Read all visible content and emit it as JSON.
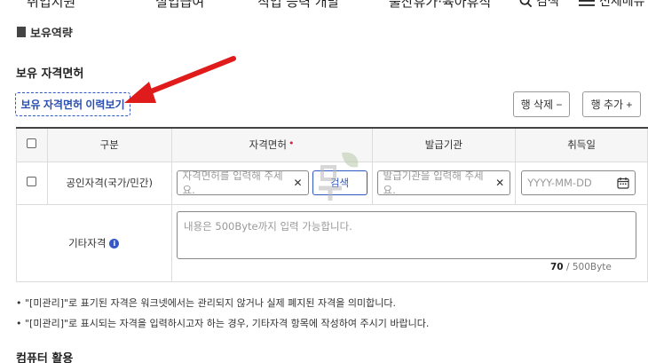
{
  "nav": {
    "items": [
      "취업지원",
      "실업급여",
      "직업 능력 개발",
      "출산휴가·육아휴직"
    ],
    "search_label": "검색",
    "menu_label": "전체메뉴"
  },
  "section_cut_title": "보유역량",
  "section_title": "보유 자격면허",
  "history_button": "보유 자격면허 이력보기",
  "delete_row_button": "행 삭제 −",
  "add_row_button": "행 추가 +",
  "table": {
    "headers": {
      "category": "구분",
      "license": "자격면허",
      "issuer": "발급기관",
      "acquired": "취득일"
    },
    "row1": {
      "category": "공인자격(국가/민간)",
      "license_placeholder": "자격면허를 입력해 주세요.",
      "search_button": "검색",
      "issuer_placeholder": "발급기관을 입력해 주세요.",
      "date_placeholder": "YYYY-MM-DD"
    },
    "row2": {
      "category": "기타자격",
      "textarea_placeholder": "내용은 500Byte까지 입력 가능합니다.",
      "counter_current": "70",
      "counter_max": " / 500Byte"
    }
  },
  "notes": [
    "\"[미관리]\"로 표기된 자격은 워크넷에서는 관리되지 않거나 실제 폐지된 자격을 의미합니다.",
    "\"[미관리]\"로 표시되는 자격을 입력하시고자 하는 경우, 기타자격 항목에 작성하여 주시기 바랍니다."
  ],
  "next_section_title": "컴퓨터 활용",
  "colors": {
    "accent": "#2f57c4",
    "arrow": "#e01b1b",
    "required": "#d6233a"
  }
}
